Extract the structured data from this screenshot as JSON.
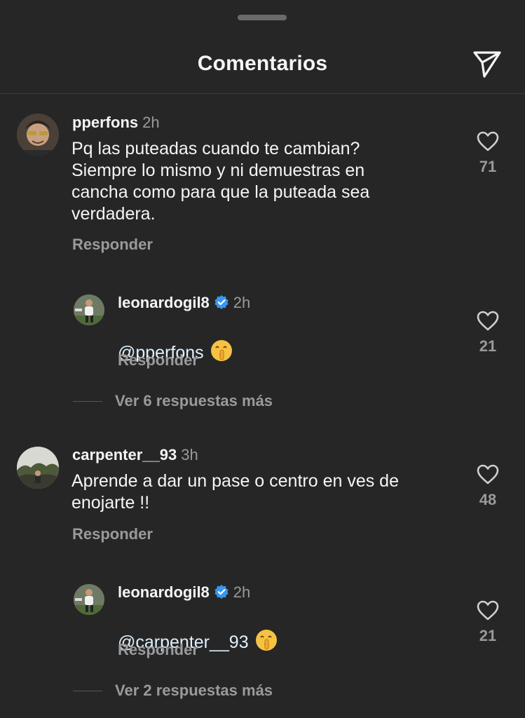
{
  "header": {
    "title": "Comentarios",
    "send_icon": "send-icon"
  },
  "colors": {
    "background": "#262626",
    "text": "#f5f5f5",
    "muted": "#9a9a9a",
    "verified": "#3897f0"
  },
  "comments": [
    {
      "username": "pperfons",
      "time": "2h",
      "text": "Pq las puteadas cuando te cambian?\nSiempre lo mismo y ni demuestras en\ncancha como para que la puteada sea\nverdadera.",
      "reply_label": "Responder",
      "likes": "71",
      "replies": [
        {
          "username": "leonardogil8",
          "verified": true,
          "time": "2h",
          "mention": "@pperfons",
          "emoji": "shushing-face-emoji",
          "reply_label": "Responder",
          "likes": "21"
        }
      ],
      "more_replies_label": "Ver 6 respuestas más"
    },
    {
      "username": "carpenter__93",
      "time": "3h",
      "text": "Aprende a dar un pase o centro en ves de\nenojarte !!",
      "reply_label": "Responder",
      "likes": "48",
      "replies": [
        {
          "username": "leonardogil8",
          "verified": true,
          "time": "2h",
          "mention": "@carpenter__93",
          "emoji": "shushing-face-emoji",
          "reply_label": "Responder",
          "likes": "21"
        }
      ],
      "more_replies_label": "Ver 2 respuestas más"
    }
  ]
}
